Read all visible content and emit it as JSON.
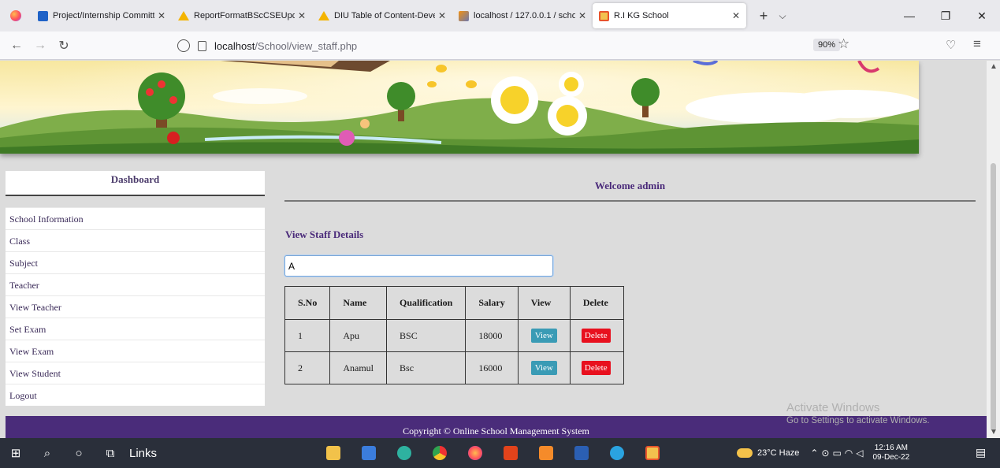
{
  "browser": {
    "tabs": [
      {
        "title": "Project/Internship Committee",
        "favicon": "table-favicon"
      },
      {
        "title": "ReportFormatBScCSEUpdated",
        "favicon": "drive-favicon"
      },
      {
        "title": "DIU Table of Content-Develop",
        "favicon": "drive-favicon"
      },
      {
        "title": "localhost / 127.0.0.1 / school",
        "favicon": "phpmyadmin-favicon"
      },
      {
        "title": "R.I KG School",
        "favicon": "school-favicon",
        "active": true
      }
    ],
    "url_host": "localhost",
    "url_path": "/School/view_staff.php",
    "zoom": "90%"
  },
  "sidebar": {
    "heading": "Dashboard",
    "items": [
      {
        "label": "School Information"
      },
      {
        "label": "Class"
      },
      {
        "label": "Subject"
      },
      {
        "label": "Teacher"
      },
      {
        "label": "View Teacher"
      },
      {
        "label": "Set Exam"
      },
      {
        "label": "View Exam"
      },
      {
        "label": "View Student"
      },
      {
        "label": "Logout"
      }
    ]
  },
  "main": {
    "welcome": "Welcome admin",
    "section_title": "View Staff Details",
    "search_value": "A",
    "table": {
      "headers": [
        "S.No",
        "Name",
        "Qualification",
        "Salary",
        "View",
        "Delete"
      ],
      "rows": [
        {
          "sno": "1",
          "name": "Apu",
          "qualification": "BSC",
          "salary": "18000",
          "view": "View",
          "delete": "Delete"
        },
        {
          "sno": "2",
          "name": "Anamul",
          "qualification": "Bsc",
          "salary": "16000",
          "view": "View",
          "delete": "Delete"
        }
      ]
    }
  },
  "footer": {
    "text": "Copyright © Online School Management System"
  },
  "watermark": {
    "line1": "Activate Windows",
    "line2": "Go to Settings to activate Windows."
  },
  "taskbar": {
    "links_label": "Links",
    "weather": "23°C  Haze",
    "time": "12:16 AM",
    "date": "09-Dec-22"
  }
}
